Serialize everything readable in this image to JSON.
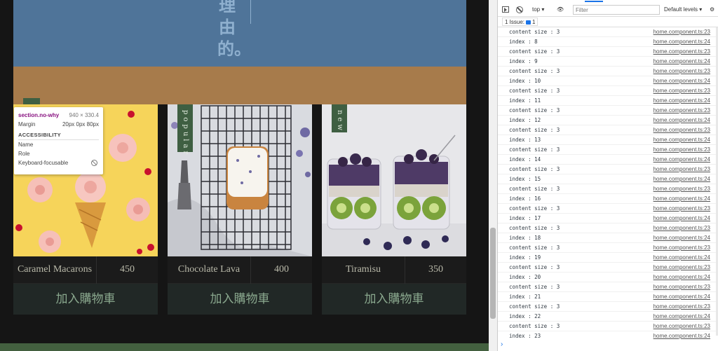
{
  "page": {
    "hero_vertical_text": "理由的。",
    "products": [
      {
        "name": "Caramel Macarons",
        "price": "450",
        "tag": "",
        "cart_label": "加入購物車"
      },
      {
        "name": "Chocolate Lava",
        "price": "400",
        "tag": "popular",
        "cart_label": "加入購物車"
      },
      {
        "name": "Tiramisu",
        "price": "350",
        "tag": "new",
        "cart_label": "加入購物車"
      }
    ],
    "colors": {
      "hero_blue": "#4f7499",
      "hero_brown": "#a77b4b",
      "tag_green": "#3f5f42",
      "cart_text": "#8aa88e"
    }
  },
  "tooltip": {
    "selector": "section.no-why",
    "dimensions": "940 × 330.4",
    "margin_label": "Margin",
    "margin_value": "20px 0px 80px",
    "accessibility_heading": "ACCESSIBILITY",
    "name_label": "Name",
    "role_label": "Role",
    "keyboard_label": "Keyboard-focusable"
  },
  "devtools": {
    "context": "top ▾",
    "filter_placeholder": "Filter",
    "levels": "Default levels ▾",
    "issues_label": "1 Issue:",
    "issues_count": "1",
    "logs": [
      {
        "msg": "content size : 3",
        "src": "home.component.ts:23"
      },
      {
        "msg": "index : 8",
        "src": "home.component.ts:24"
      },
      {
        "msg": "content size : 3",
        "src": "home.component.ts:23"
      },
      {
        "msg": "index : 9",
        "src": "home.component.ts:24"
      },
      {
        "msg": "content size : 3",
        "src": "home.component.ts:23"
      },
      {
        "msg": "index : 10",
        "src": "home.component.ts:24"
      },
      {
        "msg": "content size : 3",
        "src": "home.component.ts:23"
      },
      {
        "msg": "index : 11",
        "src": "home.component.ts:24"
      },
      {
        "msg": "content size : 3",
        "src": "home.component.ts:23"
      },
      {
        "msg": "index : 12",
        "src": "home.component.ts:24"
      },
      {
        "msg": "content size : 3",
        "src": "home.component.ts:23"
      },
      {
        "msg": "index : 13",
        "src": "home.component.ts:24"
      },
      {
        "msg": "content size : 3",
        "src": "home.component.ts:23"
      },
      {
        "msg": "index : 14",
        "src": "home.component.ts:24"
      },
      {
        "msg": "content size : 3",
        "src": "home.component.ts:23"
      },
      {
        "msg": "index : 15",
        "src": "home.component.ts:24"
      },
      {
        "msg": "content size : 3",
        "src": "home.component.ts:23"
      },
      {
        "msg": "index : 16",
        "src": "home.component.ts:24"
      },
      {
        "msg": "content size : 3",
        "src": "home.component.ts:23"
      },
      {
        "msg": "index : 17",
        "src": "home.component.ts:24"
      },
      {
        "msg": "content size : 3",
        "src": "home.component.ts:23"
      },
      {
        "msg": "index : 18",
        "src": "home.component.ts:24"
      },
      {
        "msg": "content size : 3",
        "src": "home.component.ts:23"
      },
      {
        "msg": "index : 19",
        "src": "home.component.ts:24"
      },
      {
        "msg": "content size : 3",
        "src": "home.component.ts:23"
      },
      {
        "msg": "index : 20",
        "src": "home.component.ts:24"
      },
      {
        "msg": "content size : 3",
        "src": "home.component.ts:23"
      },
      {
        "msg": "index : 21",
        "src": "home.component.ts:24"
      },
      {
        "msg": "content size : 3",
        "src": "home.component.ts:23"
      },
      {
        "msg": "index : 22",
        "src": "home.component.ts:24"
      },
      {
        "msg": "content size : 3",
        "src": "home.component.ts:23"
      },
      {
        "msg": "index : 23",
        "src": "home.component.ts:24"
      }
    ],
    "prompt_symbol": "›"
  }
}
